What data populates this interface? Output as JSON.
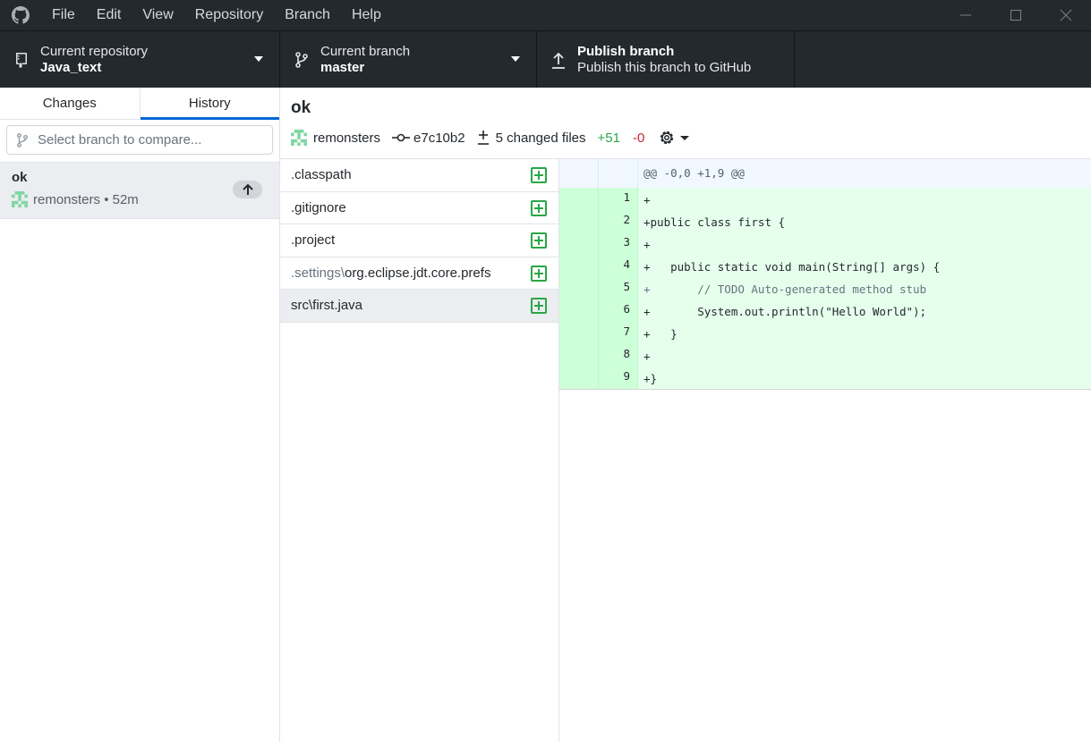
{
  "menu": [
    "File",
    "Edit",
    "View",
    "Repository",
    "Branch",
    "Help"
  ],
  "toolbar": {
    "repo_label": "Current repository",
    "repo_name": "Java_text",
    "branch_label": "Current branch",
    "branch_name": "master",
    "publish_title": "Publish branch",
    "publish_desc": "Publish this branch to GitHub"
  },
  "sidebar": {
    "tabs": [
      "Changes",
      "History"
    ],
    "active_tab": "History",
    "compare_placeholder": "Select branch to compare...",
    "commits": [
      {
        "title": "ok",
        "author": "remonsters",
        "time": "52m"
      }
    ],
    "meta_separator": " • "
  },
  "commit": {
    "title": "ok",
    "author": "remonsters",
    "sha": "e7c10b2",
    "changed_files": "5 changed files",
    "additions": "+51",
    "deletions": "-0"
  },
  "files": [
    {
      "dir": "",
      "name": ".classpath"
    },
    {
      "dir": "",
      "name": ".gitignore"
    },
    {
      "dir": "",
      "name": ".project"
    },
    {
      "dir": ".settings\\",
      "name": "org.eclipse.jdt.core.prefs"
    },
    {
      "dir": "",
      "name": "src\\first.java",
      "selected": true
    }
  ],
  "diff": {
    "hunk": "@@ -0,0 +1,9 @@",
    "lines": [
      {
        "num": "1",
        "text": "+"
      },
      {
        "num": "2",
        "text": "+public class first {"
      },
      {
        "num": "3",
        "text": "+"
      },
      {
        "num": "4",
        "text": "+   public static void main(String[] args) {"
      },
      {
        "num": "5",
        "text": "+       // TODO Auto-generated method stub"
      },
      {
        "num": "6",
        "text": "+       System.out.println(\"Hello World\");"
      },
      {
        "num": "7",
        "text": "+   }"
      },
      {
        "num": "8",
        "text": "+"
      },
      {
        "num": "9",
        "text": "+}"
      }
    ]
  },
  "colors": {
    "accent": "#0366d6",
    "added": "#28a745",
    "deleted": "#cb2431",
    "titlebar": "#24292e"
  },
  "icons": {
    "app": "github-logo-icon",
    "repo": "repo-icon",
    "branch": "git-branch-icon",
    "publish": "arrow-up-icon"
  }
}
